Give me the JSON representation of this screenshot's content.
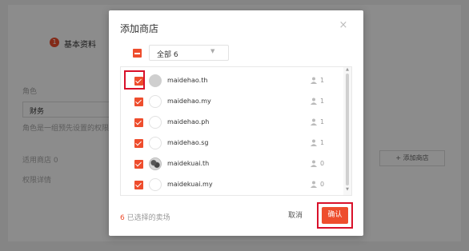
{
  "background": {
    "step_number": "1",
    "step_label": "基本资料",
    "role_label": "角色",
    "role_value": "财务",
    "role_hint": "角色是一组预先设置的权限，",
    "shops_label": "适用商店 0",
    "permissions_label": "权限详情",
    "add_shop_button": "+ 添加商店"
  },
  "modal": {
    "title": "添加商店",
    "close_symbol": "×",
    "select_all_label": "全部 6",
    "shops": [
      {
        "name": "maidehao.th",
        "count": "1",
        "avatar": "gray"
      },
      {
        "name": "maidehao.my",
        "count": "1",
        "avatar": "blank"
      },
      {
        "name": "maidehao.ph",
        "count": "1",
        "avatar": "blank"
      },
      {
        "name": "maidehao.sg",
        "count": "1",
        "avatar": "blank"
      },
      {
        "name": "maidekuai.th",
        "count": "0",
        "avatar": "photo"
      },
      {
        "name": "maidekuai.my",
        "count": "0",
        "avatar": "blank"
      }
    ],
    "selected_count": "6",
    "selected_suffix": " 已选择的卖场",
    "cancel_label": "取消",
    "confirm_label": "确认"
  },
  "colors": {
    "accent": "#ee4d2d",
    "highlight": "#d9112a"
  }
}
